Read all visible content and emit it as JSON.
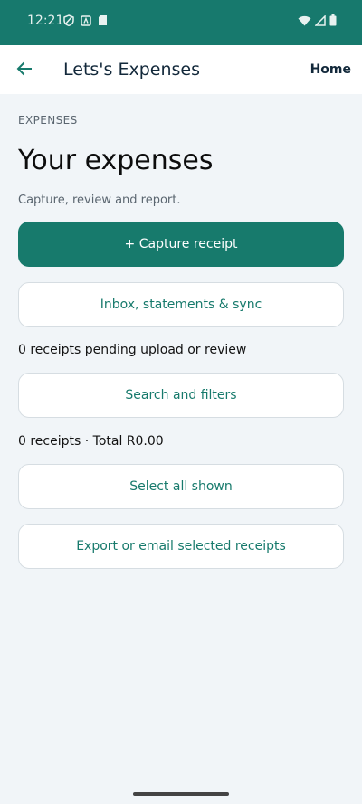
{
  "status_bar": {
    "time": "12:21"
  },
  "app_bar": {
    "title": "Lets's Expenses",
    "home_label": "Home"
  },
  "main": {
    "eyebrow": "EXPENSES",
    "title": "Your expenses",
    "subtitle": "Capture, review and report.",
    "capture_button": "+ Capture receipt",
    "inbox_button": "Inbox, statements & sync",
    "pending_text": "0 receipts pending upload or review",
    "search_button": "Search and filters",
    "summary_text": "0 receipts · Total R0.00",
    "select_all_button": "Select all shown",
    "export_button": "Export or email selected receipts"
  },
  "colors": {
    "primary": "#177a6c",
    "status_bar": "#17796d",
    "background": "#f1f5f8"
  }
}
